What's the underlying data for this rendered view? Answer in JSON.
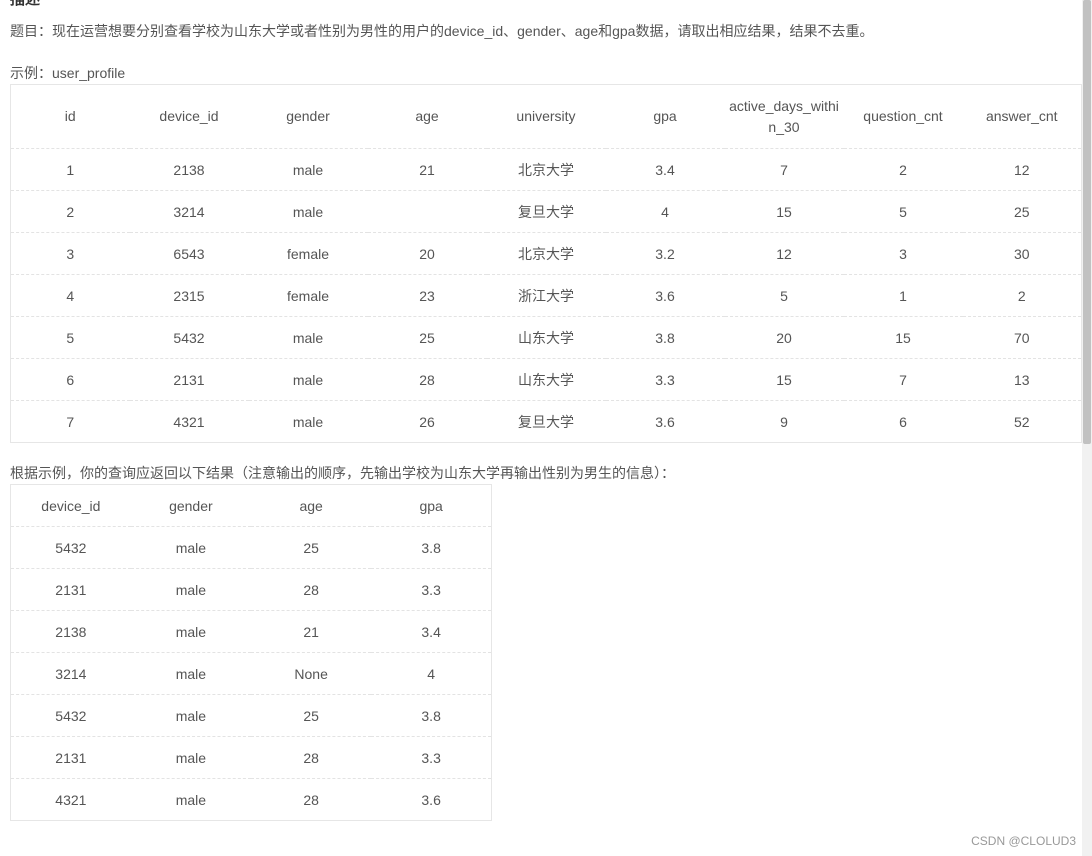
{
  "heading": "描述",
  "description": "题目：现在运营想要分别查看学校为山东大学或者性别为男性的用户的device_id、gender、age和gpa数据，请取出相应结果，结果不去重。",
  "example_label": "示例：user_profile",
  "table1": {
    "headers": [
      "id",
      "device_id",
      "gender",
      "age",
      "university",
      "gpa",
      "active_days_within_30",
      "question_cnt",
      "answer_cnt"
    ],
    "header_active_part1": "active_days_withi",
    "header_active_part2": "n_30",
    "rows": [
      [
        "1",
        "2138",
        "male",
        "21",
        "北京大学",
        "3.4",
        "7",
        "2",
        "12"
      ],
      [
        "2",
        "3214",
        "male",
        "",
        "复旦大学",
        "4",
        "15",
        "5",
        "25"
      ],
      [
        "3",
        "6543",
        "female",
        "20",
        "北京大学",
        "3.2",
        "12",
        "3",
        "30"
      ],
      [
        "4",
        "2315",
        "female",
        "23",
        "浙江大学",
        "3.6",
        "5",
        "1",
        "2"
      ],
      [
        "5",
        "5432",
        "male",
        "25",
        "山东大学",
        "3.8",
        "20",
        "15",
        "70"
      ],
      [
        "6",
        "2131",
        "male",
        "28",
        "山东大学",
        "3.3",
        "15",
        "7",
        "13"
      ],
      [
        "7",
        "4321",
        "male",
        "26",
        "复旦大学",
        "3.6",
        "9",
        "6",
        "52"
      ]
    ]
  },
  "result_label": "根据示例，你的查询应返回以下结果（注意输出的顺序，先输出学校为山东大学再输出性别为男生的信息）：",
  "table2": {
    "headers": [
      "device_id",
      "gender",
      "age",
      "gpa"
    ],
    "rows": [
      [
        "5432",
        "male",
        "25",
        "3.8"
      ],
      [
        "2131",
        "male",
        "28",
        "3.3"
      ],
      [
        "2138",
        "male",
        "21",
        "3.4"
      ],
      [
        "3214",
        "male",
        "None",
        "4"
      ],
      [
        "5432",
        "male",
        "25",
        "3.8"
      ],
      [
        "2131",
        "male",
        "28",
        "3.3"
      ],
      [
        "4321",
        "male",
        "28",
        "3.6"
      ]
    ]
  },
  "watermark": "CSDN @CLOLUD3"
}
